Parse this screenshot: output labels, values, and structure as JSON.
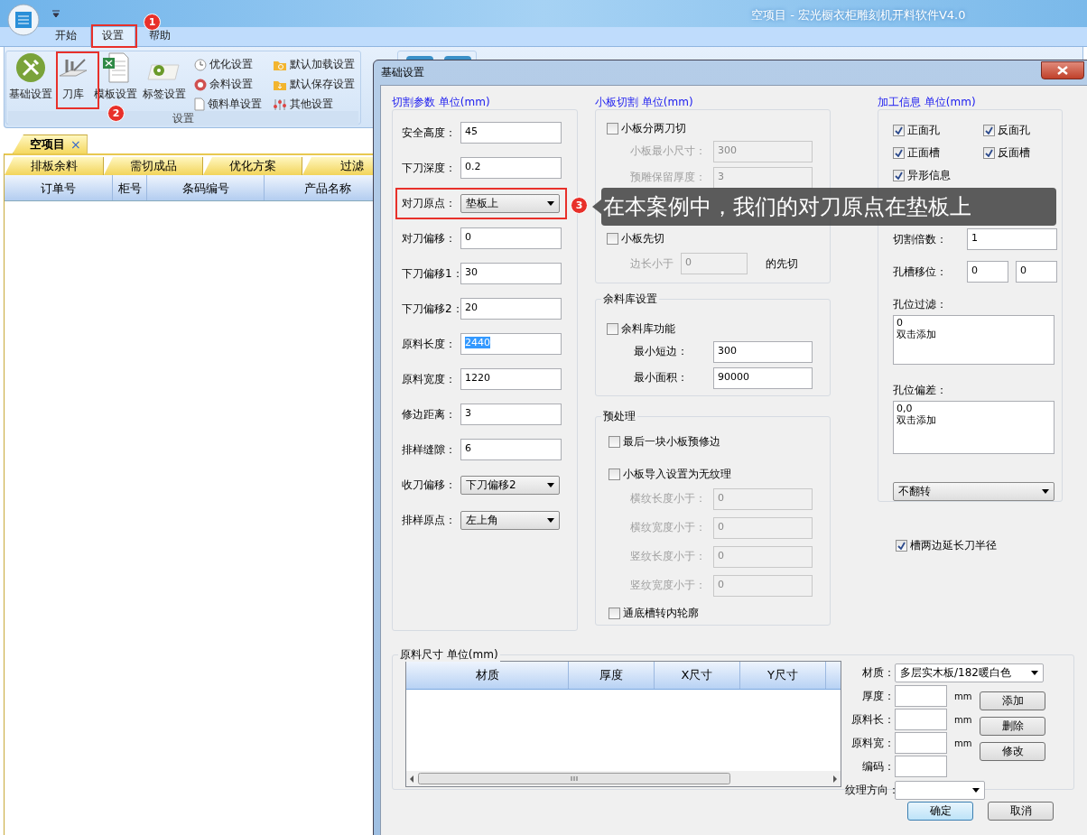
{
  "app": {
    "title": "空项目 - 宏光橱衣柜雕刻机开料软件V4.0",
    "ribbon_tabs": [
      {
        "label": "开始",
        "selected": false
      },
      {
        "label": "设置",
        "selected": true
      },
      {
        "label": "帮助",
        "selected": false
      }
    ],
    "ribbon_large": [
      {
        "label": "基础设置",
        "kind": "tools"
      },
      {
        "label": "刀库",
        "kind": "knife"
      },
      {
        "label": "模板设置",
        "kind": "sheet"
      },
      {
        "label": "标签设置",
        "kind": "label"
      }
    ],
    "ribbon_small": [
      {
        "label": "优化设置",
        "kind": "clock"
      },
      {
        "label": "余料设置",
        "kind": "coin"
      },
      {
        "label": "领料单设置",
        "kind": "doc"
      },
      {
        "label": "默认加载设置",
        "kind": "folder-refresh"
      },
      {
        "label": "默认保存设置",
        "kind": "folder-down"
      },
      {
        "label": "其他设置",
        "kind": "sliders"
      }
    ],
    "ribbon_group": "设置",
    "document_tab": {
      "label": "空项目",
      "close": "×"
    },
    "sub_tabs": [
      "排板余料",
      "需切成品",
      "优化方案",
      "过滤"
    ],
    "table": {
      "columns": [
        "订单号",
        "柜号",
        "条码编号",
        "产品名称"
      ]
    }
  },
  "dialog": {
    "title": "基础设置",
    "cutting": {
      "title": "切割参数 单位(mm)",
      "fields": [
        {
          "label": "安全高度：",
          "value": "45",
          "kind": "text",
          "focused": false
        },
        {
          "label": "下刀深度：",
          "value": "0.2",
          "kind": "text",
          "focused": false
        },
        {
          "label": "对刀原点：",
          "value": "垫板上",
          "kind": "select"
        },
        {
          "label": "对刀偏移：",
          "value": "0",
          "kind": "text",
          "focused": false
        },
        {
          "label": "下刀偏移1：",
          "value": "30",
          "kind": "text",
          "focused": false
        },
        {
          "label": "下刀偏移2：",
          "value": "20",
          "kind": "text",
          "focused": false
        },
        {
          "label": "原料长度：",
          "value": "2440",
          "kind": "text",
          "focused": true
        },
        {
          "label": "原料宽度：",
          "value": "1220",
          "kind": "text",
          "focused": false
        },
        {
          "label": "修边距离：",
          "value": "3",
          "kind": "text",
          "focused": false
        },
        {
          "label": "排样缝隙：",
          "value": "6",
          "kind": "text",
          "focused": false
        },
        {
          "label": "收刀偏移：",
          "value": "下刀偏移2",
          "kind": "select"
        },
        {
          "label": "排样原点：",
          "value": "左上角",
          "kind": "select"
        }
      ]
    },
    "small_board": {
      "title": "小板切割 单位(mm)",
      "split": {
        "label": "小板分两刀切",
        "checked": false
      },
      "fields": [
        {
          "label": "小板最小尺寸：",
          "value": "300",
          "kind": "text",
          "disabled": true
        },
        {
          "label": "预雕保留厚度：",
          "value": "3",
          "kind": "text",
          "disabled": true
        }
      ],
      "first_cut": {
        "label": "小板先切",
        "checked": false
      },
      "edge": {
        "prefix": "边长小于",
        "value": "0",
        "suffix": "的先切",
        "disabled": true
      }
    },
    "remnant": {
      "title": "余料库设置",
      "enable": {
        "label": "余料库功能",
        "checked": false
      },
      "fields": [
        {
          "label": "最小短边：",
          "value": "300",
          "kind": "text",
          "disabled": false
        },
        {
          "label": "最小面积：",
          "value": "90000",
          "kind": "text",
          "disabled": false
        }
      ]
    },
    "preprocess": {
      "title": "预处理",
      "options": [
        {
          "label": "最后一块小板预修边",
          "checked": false
        },
        {
          "label": "小板导入设置为无纹理",
          "checked": false
        }
      ],
      "fields": [
        {
          "label": "横纹长度小于：",
          "value": "0",
          "kind": "text",
          "disabled": true
        },
        {
          "label": "横纹宽度小于：",
          "value": "0",
          "kind": "text",
          "disabled": true
        },
        {
          "label": "竖纹长度小于：",
          "value": "0",
          "kind": "text",
          "disabled": true
        },
        {
          "label": "竖纹宽度小于：",
          "value": "0",
          "kind": "text",
          "disabled": true
        }
      ],
      "through_slot": {
        "label": "通底槽转内轮廓",
        "checked": false
      }
    },
    "processing": {
      "title": "加工信息 单位(mm)",
      "options": [
        {
          "label": "正面孔",
          "checked": true
        },
        {
          "label": "反面孔",
          "checked": true
        },
        {
          "label": "正面槽",
          "checked": true
        },
        {
          "label": "反面槽",
          "checked": true
        },
        {
          "label": "异形信息",
          "checked": true
        }
      ],
      "cut_multiplier": {
        "label": "切割倍数：",
        "value": "1"
      },
      "hole_shift": {
        "label": "孔槽移位：",
        "values": [
          "0",
          "0"
        ]
      },
      "hole_filter": {
        "label": "孔位过滤：",
        "text": "0\n双击添加"
      },
      "hole_tolerance": {
        "label": "孔位偏差：",
        "text": "0,0\n双击添加"
      },
      "flip": {
        "value": "不翻转"
      }
    },
    "extend_slot": {
      "label": "槽两边延长刀半径",
      "checked": true
    },
    "material": {
      "title": "原料尺寸 单位(mm)",
      "columns": [
        "材质",
        "厚度",
        "X尺寸",
        "Y尺寸"
      ],
      "form": [
        {
          "label": "材质：",
          "kind": "select",
          "value": "多层实木板/182暖白色"
        },
        {
          "label": "厚度：",
          "kind": "text",
          "unit": "mm"
        },
        {
          "label": "原料长：",
          "kind": "text",
          "unit": "mm"
        },
        {
          "label": "原料宽：",
          "kind": "text",
          "unit": "mm"
        },
        {
          "label": "编码：",
          "kind": "text"
        },
        {
          "label": "纹理方向：",
          "kind": "select"
        }
      ],
      "buttons": [
        "添加",
        "删除",
        "修改"
      ]
    },
    "buttons": [
      {
        "label": "确定",
        "default": true
      },
      {
        "label": "取消",
        "default": false
      }
    ]
  },
  "annotations": {
    "markers": [
      "1",
      "2",
      "3"
    ],
    "tooltip": "在本案例中，我们的对刀原点在垫板上"
  }
}
